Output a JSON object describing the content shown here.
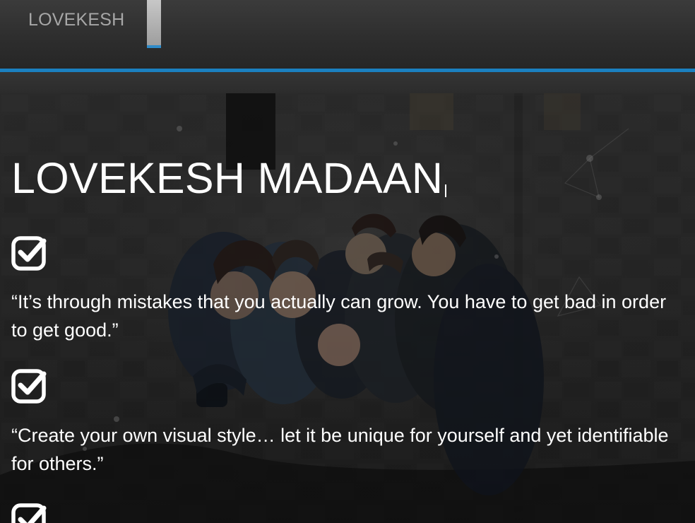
{
  "navbar": {
    "brand": "LOVEKESH",
    "accent_color": "#1b80c0",
    "toggle_icon": "menu-toggle-icon"
  },
  "hero": {
    "title": "LOVEKESH MADAAN",
    "check_icon": "check-square-icon",
    "quotes": [
      "“It’s through mistakes that you actually can grow. You have to get bad in order\nto get good.”",
      "“Create your own visual style… let it be unique for yourself and yet identifiable\nfor others.”"
    ]
  }
}
